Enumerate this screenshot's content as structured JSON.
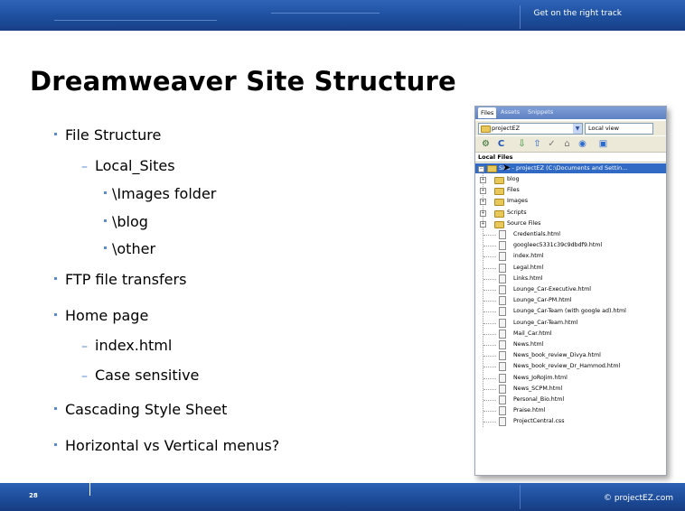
{
  "header": {
    "tagline": "Get on the right track"
  },
  "slide": {
    "title": "Dreamweaver Site Structure"
  },
  "bullets": [
    {
      "level": 1,
      "text": "File Structure"
    },
    {
      "level": 2,
      "text": "Local_Sites"
    },
    {
      "level": 3,
      "text": "\\Images folder"
    },
    {
      "level": 3,
      "text": "\\blog"
    },
    {
      "level": 3,
      "text": "\\other"
    },
    {
      "level": 1,
      "text": "FTP file transfers"
    },
    {
      "level": 1,
      "text": "Home page"
    },
    {
      "level": 2,
      "text": "index.html"
    },
    {
      "level": 2,
      "text": "Case sensitive"
    },
    {
      "level": 1,
      "text": "Cascading Style Sheet"
    },
    {
      "level": 1,
      "text": "Horizontal vs Vertical menus?"
    }
  ],
  "files_panel": {
    "tabs": [
      "Files",
      "Assets",
      "Snippets"
    ],
    "site_select": "projectEZ",
    "view_select": "Local view",
    "local_files_header": "Local Files",
    "site_root": "Site - projectEZ (C:\\Documents and Settin...",
    "folders": [
      "blog",
      "Files",
      "Images",
      "Scripts",
      "Source Files"
    ],
    "files": [
      "Credentials.html",
      "googleec5331c39c9dbdf9.html",
      "index.html",
      "Legal.html",
      "Links.html",
      "Lounge_Car-Executive.html",
      "Lounge_Car-PM.html",
      "Lounge_Car-Team (with google ad).html",
      "Lounge_Car-Team.html",
      "Mail_Car.html",
      "News.html",
      "News_book_review_Divya.html",
      "News_book_review_Dr_Hammod.html",
      "News_JoRoJim.html",
      "News_SCPM.html",
      "Personal_Bio.html",
      "Praise.html",
      "ProjectCentral.css"
    ]
  },
  "footer": {
    "page_number": "28",
    "copyright": "© projectEZ.com"
  }
}
